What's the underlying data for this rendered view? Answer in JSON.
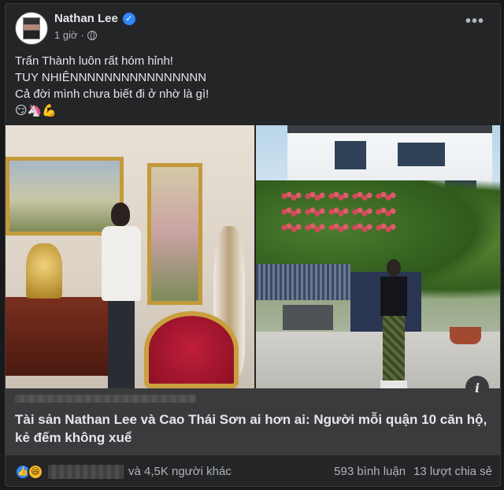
{
  "post": {
    "author": "Nathan Lee",
    "time": "1 giờ",
    "menu_glyph": "•••",
    "text_lines": [
      "Trấn Thành luôn rất hóm hỉnh!",
      "TUY NHIÊNNNNNNNNNNNNNNNN",
      "Cả đời mình chưa biết đi ở nhờ là gì!"
    ],
    "emojis": "😏🦄💪"
  },
  "link": {
    "title": "Tài sản Nathan Lee và Cao Thái Sơn ai hơn ai: Người mỗi quận 10 căn hộ, kẻ đếm không xuể",
    "info_glyph": "i"
  },
  "footer": {
    "others_text": "và 4,5K người khác",
    "comments": "593 bình luận",
    "shares": "13 lượt chia sẻ"
  },
  "icons": {
    "verified": "verified-badge-icon",
    "privacy": "globe-icon",
    "reactions": [
      "like-icon",
      "haha-icon"
    ]
  },
  "colors": {
    "background": "#242526",
    "text": "#e4e6eb",
    "secondary_text": "#b0b3b8",
    "accent": "#2d88ff",
    "link_box": "#3a3b3c"
  }
}
